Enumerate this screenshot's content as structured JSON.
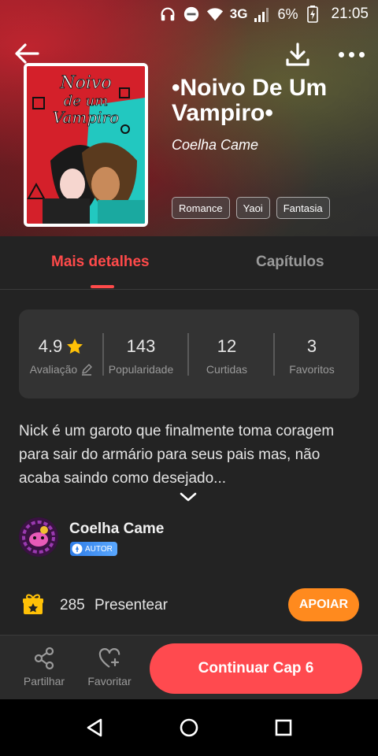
{
  "status_bar": {
    "network": "3G",
    "battery": "6%",
    "time": "21:05",
    "icons": [
      "headphones-icon",
      "do-not-disturb-icon",
      "wifi-icon",
      "signal-icon",
      "battery-charging-icon"
    ]
  },
  "header": {
    "title": "•Noivo De Um Vampiro•",
    "author": "Coelha Came",
    "tags": [
      "Romance",
      "Yaoi",
      "Fantasia"
    ],
    "cover_text": [
      "Noivo",
      "de um",
      "Vampiro"
    ]
  },
  "tabs": [
    {
      "label": "Mais detalhes",
      "active": true
    },
    {
      "label": "Capítulos",
      "active": false
    }
  ],
  "stats": {
    "rating": {
      "value": "4.9",
      "label": "Avaliação"
    },
    "popularity": {
      "value": "143",
      "label": "Popularidade"
    },
    "likes": {
      "value": "12",
      "label": "Curtidas"
    },
    "favorites": {
      "value": "3",
      "label": "Favoritos"
    }
  },
  "description": "Nick é um garoto que finalmente toma coragem para sair do armário para seus pais mas, não acaba saindo como desejado...",
  "author_row": {
    "name": "Coelha Came",
    "badge": "AUTOR"
  },
  "gifts": {
    "count": "285",
    "label": "Presentear",
    "support_label": "APOIAR"
  },
  "action_bar": {
    "share_label": "Partilhar",
    "favorite_label": "Favoritar",
    "continue_label": "Continuar Cap 6"
  },
  "colors": {
    "accent": "#ff4a4f",
    "support": "#ff8a1e",
    "badge": "#3a8af0",
    "background": "#232323"
  }
}
